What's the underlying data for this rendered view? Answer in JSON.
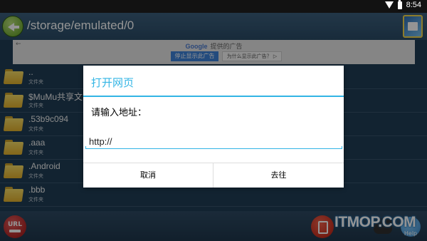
{
  "status_bar": {
    "time": "8:54"
  },
  "path_bar": {
    "path": "/storage/emulated/0"
  },
  "ad": {
    "back": "←",
    "brand": "Google",
    "provided_by": "提供的广告",
    "stop_label": "停止显示此广告",
    "why_label": "为什么显示此广告？ ▷"
  },
  "files": [
    {
      "name": "..",
      "sub": "文件夹"
    },
    {
      "name": "$MuMu共享文",
      "sub": "文件夹"
    },
    {
      "name": ".53b9c094",
      "sub": "文件夹"
    },
    {
      "name": ".aaa",
      "sub": "文件夹"
    },
    {
      "name": ".Android",
      "sub": "文件夹"
    },
    {
      "name": ".bbb",
      "sub": "文件夹"
    }
  ],
  "bottom_bar": {
    "url_label": "URL",
    "help_label": "Help",
    "watermark": "ITMOP.COM"
  },
  "dialog": {
    "title": "打开网页",
    "prompt": "请输入地址：",
    "input_value": "http://",
    "cancel_label": "取消",
    "go_label": "去往"
  },
  "colors": {
    "accent": "#33b5e5",
    "background": "#1f3d55"
  }
}
